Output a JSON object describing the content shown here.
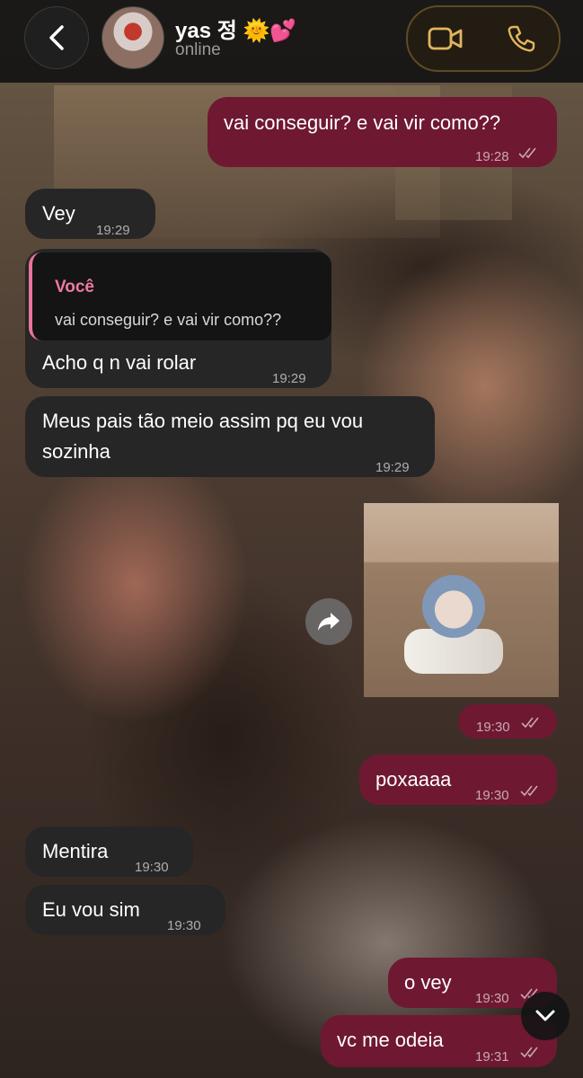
{
  "header": {
    "contact_name": "yas 정 🌞💕",
    "status": "online",
    "icons": [
      "back-chevron-icon",
      "video-call-icon",
      "phone-icon"
    ]
  },
  "messages": [
    {
      "dir": "out",
      "text": "vai conseguir? e vai vir como??",
      "time": "19:28",
      "read": true
    },
    {
      "dir": "in",
      "text": "Vey",
      "time": "19:29"
    },
    {
      "dir": "in",
      "reply_to": {
        "author": "Você",
        "text": "vai conseguir? e vai vir como??"
      },
      "text": "Acho q n vai rolar",
      "time": "19:29"
    },
    {
      "dir": "in",
      "text_line1": "Meus pais tão meio assim pq eu vou",
      "text_line2": "sozinha",
      "time": "19:29"
    },
    {
      "dir": "out",
      "type": "image",
      "time": "19:30",
      "read": true
    },
    {
      "dir": "out",
      "text": "poxaaaa",
      "time": "19:30",
      "read": true
    },
    {
      "dir": "in",
      "text": "Mentira",
      "time": "19:30"
    },
    {
      "dir": "in",
      "text": "Eu vou sim",
      "time": "19:30"
    },
    {
      "dir": "out",
      "text": "o vey",
      "time": "19:30",
      "read": true
    },
    {
      "dir": "out",
      "text": "vc me odeia",
      "time": "19:31",
      "read": true
    }
  ],
  "colors": {
    "outgoing_bubble": "#6f1832",
    "incoming_bubble": "#262626",
    "reply_accent": "#ee7aa0",
    "call_border": "#5e4a25"
  }
}
